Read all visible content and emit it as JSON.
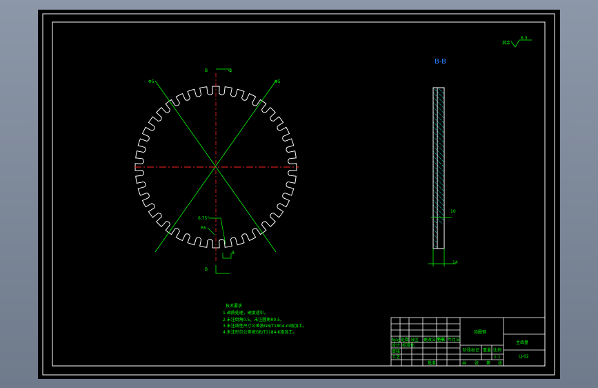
{
  "drawing": {
    "section_label": "B-B",
    "cut_mark_top": "B",
    "cut_mark_bottom": "B",
    "roughness_prefix": "其余",
    "roughness_value": "6.3",
    "dim_angle": "6.75°",
    "dim_r": "R5",
    "dim_small": "8",
    "dim_d1": "Φ5",
    "dim_d2": "Φ5",
    "side_dim_1": "10",
    "side_dim_2": "14",
    "tooth_count": 40
  },
  "notes": {
    "title": "技术要求",
    "lines": [
      "1.调质处理，硬度适中。",
      "2.未注倒角0.5，未注圆角R0.5。",
      "3.未注线性尺寸公差按GB/T1804-m级加工。",
      "4.未注形位公差按GB/T1184-K级加工。"
    ]
  },
  "title_block": {
    "material": "齿圈钢",
    "part_name": "主齿盘",
    "drawing_no": "LJ-02",
    "scale": "1:1",
    "stage_label": "阶段标记",
    "weight_label": "重量",
    "scale_label": "比例",
    "row_labels": [
      "标记",
      "处数",
      "分区",
      "更改文件号",
      "签名",
      "年月日"
    ],
    "left_labels": [
      "设计",
      "审核",
      "工艺",
      "标准化",
      "批准"
    ],
    "bottom_labels": [
      "共",
      "张",
      "第",
      "张"
    ]
  }
}
